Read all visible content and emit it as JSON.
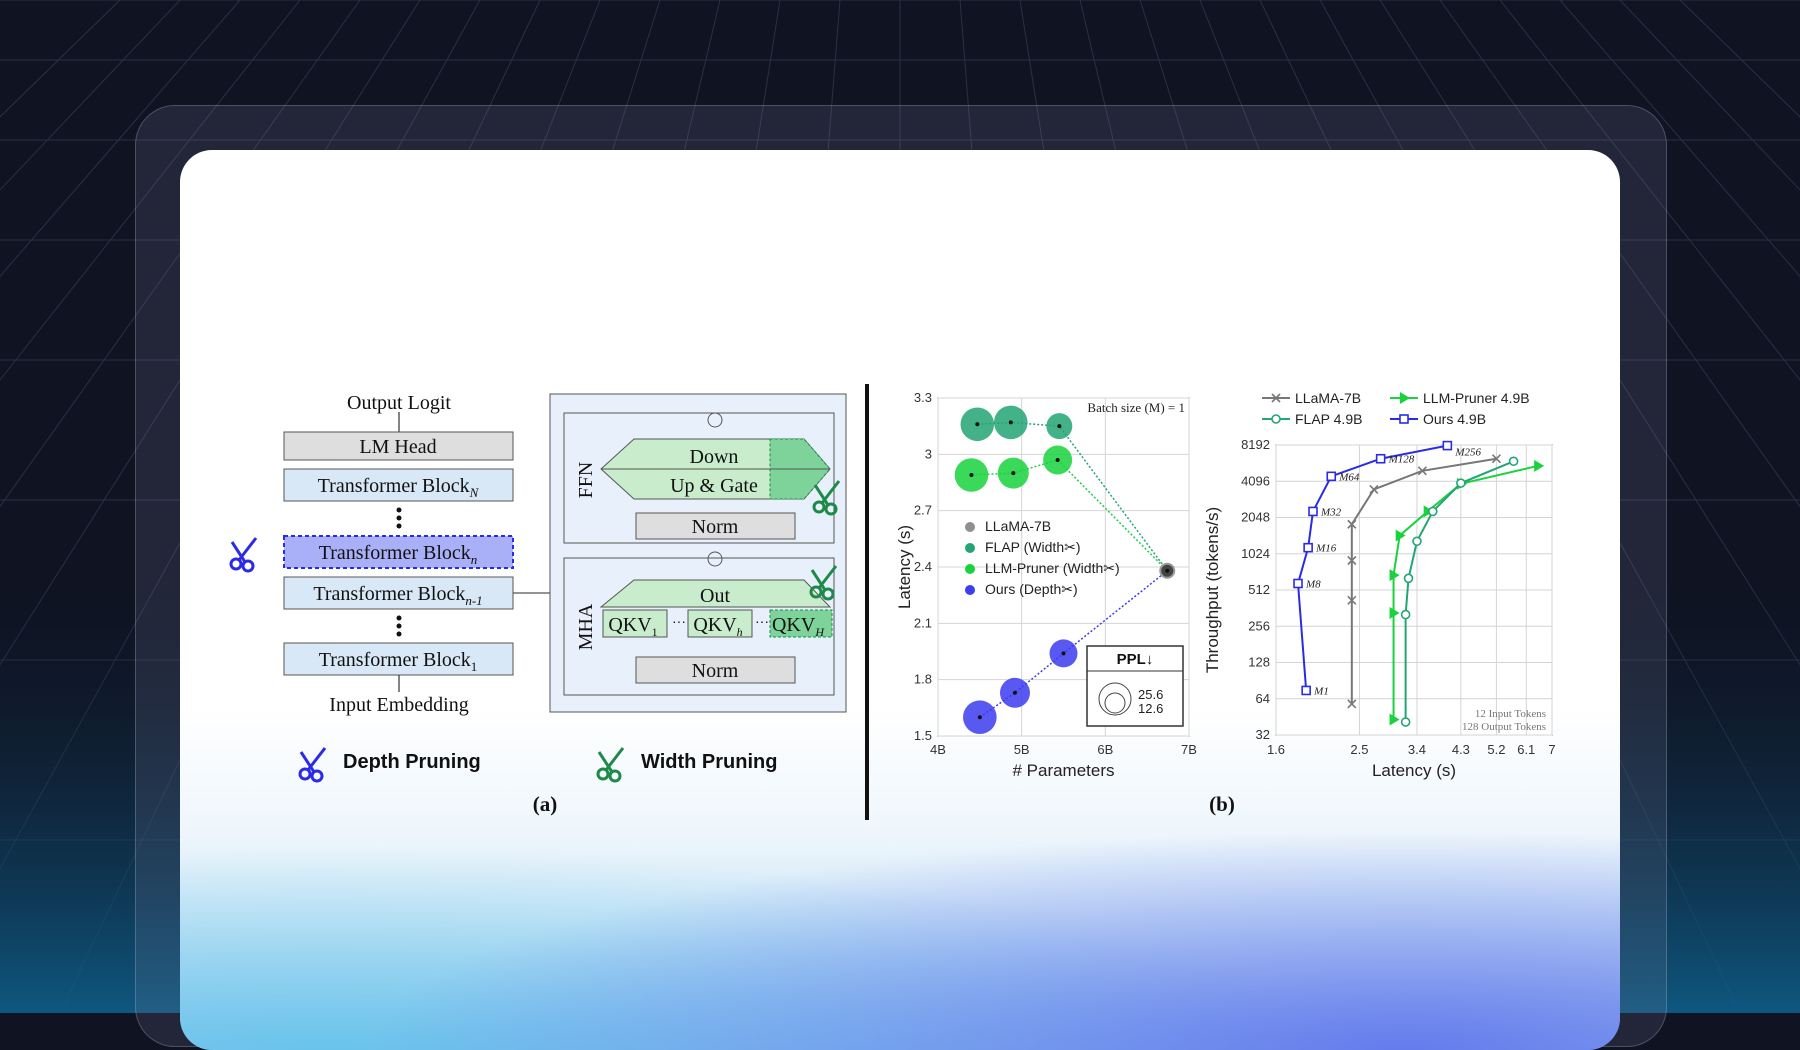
{
  "panel_a": {
    "output_logit": "Output Logit",
    "lm_head": "LM Head",
    "block_prefix": "Transformer Block",
    "block_N_sub": "N",
    "block_n_sub": "n",
    "block_n1_sub": "n-1",
    "block_1_sub": "1",
    "input_embedding": "Input Embedding",
    "ffn_label": "FFN",
    "down": "Down",
    "up_gate": "Up & Gate",
    "norm_top": "Norm",
    "mha_label": "MHA",
    "out": "Out",
    "qkv_prefix": "QKV",
    "qkv_sub_1": "1",
    "qkv_sub_h": "h",
    "qkv_sub_H": "H",
    "norm_bottom": "Norm",
    "depth_pruning": "Depth Pruning",
    "width_pruning": "Width Pruning",
    "caption": "(a)"
  },
  "panel_b": {
    "caption": "(b)",
    "scatter": {
      "type": "scatter",
      "batch_note": "Batch size (M) = 1",
      "xlabel": "# Parameters",
      "ylabel": "Latency (s)",
      "xticks": [
        "4B",
        "5B",
        "6B",
        "7B"
      ],
      "yticks": [
        "1.5",
        "1.8",
        "2.1",
        "2.4",
        "2.7",
        "3",
        "3.3"
      ],
      "xlim": [
        4,
        7
      ],
      "ylim": [
        1.5,
        3.3
      ],
      "legend": [
        "LLaMA-7B",
        "FLAP (Width✂)",
        "LLM-Pruner (Width✂)",
        "Ours (Depth✂)"
      ],
      "ppl_title": "PPL↓",
      "ppl_big": "25.6",
      "ppl_small": "12.6",
      "colors": {
        "llama": "#444444",
        "flap": "#23a574",
        "llmpruner": "#19d23c",
        "ours": "#3c3cf0"
      },
      "series": [
        {
          "name": "LLaMA-7B",
          "points": [
            [
              6.74,
              2.38
            ]
          ],
          "sizes": [
            12.6
          ]
        },
        {
          "name": "FLAP (Width✂)",
          "points": [
            [
              4.47,
              3.16
            ],
            [
              4.87,
              3.17
            ],
            [
              5.45,
              3.15
            ]
          ],
          "sizes": [
            25.6,
            25.6,
            18
          ]
        },
        {
          "name": "LLM-Pruner (Width✂)",
          "points": [
            [
              4.4,
              2.89
            ],
            [
              4.9,
              2.9
            ],
            [
              5.43,
              2.97
            ]
          ],
          "sizes": [
            25.6,
            23,
            21
          ]
        },
        {
          "name": "Ours (Depth✂)",
          "points": [
            [
              4.5,
              1.6
            ],
            [
              4.92,
              1.73
            ],
            [
              5.5,
              1.94
            ]
          ],
          "sizes": [
            25.6,
            22,
            20
          ]
        }
      ]
    },
    "throughput": {
      "type": "line",
      "xlabel": "Latency (s)",
      "ylabel": "Throughput (tokens/s)",
      "xticks": [
        "1.6",
        "2.5",
        "3.4",
        "4.3",
        "5.2",
        "6.1",
        "7"
      ],
      "yticks": [
        "32",
        "64",
        "128",
        "256",
        "512",
        "1024",
        "2048",
        "4096",
        "8192"
      ],
      "xlim": [
        1.6,
        7
      ],
      "ylim": [
        32,
        8192
      ],
      "log_y": true,
      "legend": [
        "LLaMA-7B",
        "LLM-Pruner 4.9B",
        "FLAP 4.9B",
        "Ours 4.9B"
      ],
      "note_1": "12 Input Tokens",
      "note_2": "128 Output Tokens",
      "m_labels": [
        "M1",
        "M8",
        "M16",
        "M32",
        "M64",
        "M128",
        "M256"
      ],
      "colors": {
        "llama": "#777777",
        "llmpruner": "#19d23c",
        "flap": "#23a574",
        "ours": "#2b2be6"
      },
      "series": [
        {
          "name": "LLaMA-7B",
          "points": [
            [
              2.4,
              58
            ],
            [
              2.4,
              420
            ],
            [
              2.4,
              900
            ],
            [
              2.4,
              1800
            ],
            [
              2.7,
              3500
            ],
            [
              3.5,
              5000
            ],
            [
              5.2,
              6300
            ]
          ]
        },
        {
          "name": "LLM-Pruner 4.9B",
          "points": [
            [
              3.0,
              43
            ],
            [
              3.0,
              330
            ],
            [
              3.0,
              680
            ],
            [
              3.1,
              1450
            ],
            [
              3.6,
              2300
            ],
            [
              4.3,
              3900
            ],
            [
              6.5,
              5500
            ]
          ]
        },
        {
          "name": "FLAP 4.9B",
          "points": [
            [
              3.2,
              41
            ],
            [
              3.2,
              320
            ],
            [
              3.25,
              640
            ],
            [
              3.4,
              1300
            ],
            [
              3.7,
              2300
            ],
            [
              4.3,
              3950
            ],
            [
              5.7,
              6000
            ]
          ]
        },
        {
          "name": "Ours 4.9B",
          "points": [
            [
              1.88,
              75
            ],
            [
              1.8,
              580
            ],
            [
              1.9,
              1150
            ],
            [
              1.95,
              2300
            ],
            [
              2.15,
              4500
            ],
            [
              2.8,
              6300
            ],
            [
              4.0,
              8100
            ]
          ]
        }
      ]
    }
  }
}
